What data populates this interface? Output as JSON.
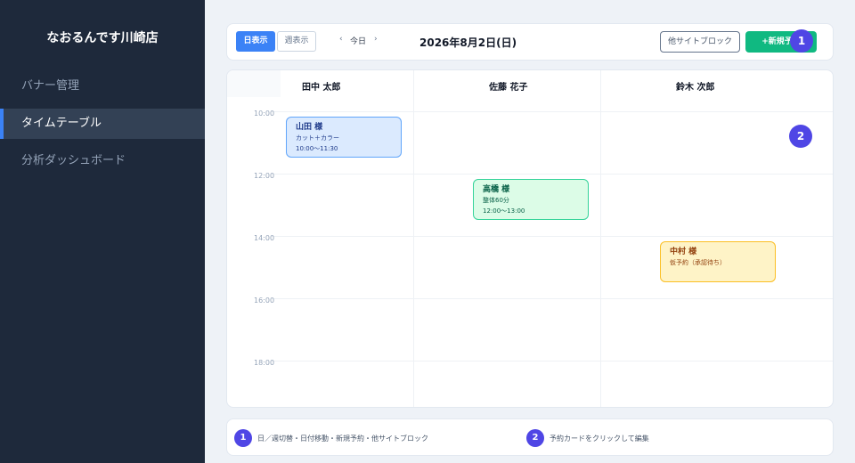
{
  "sidebar": {
    "brand": "なおるんです川崎店",
    "items": [
      {
        "label": "バナー管理"
      },
      {
        "label": "タイムテーブル"
      },
      {
        "label": "分析ダッシュボード"
      }
    ]
  },
  "toolbar": {
    "day_view": "日表示",
    "week_view": "週表示",
    "prev": "‹",
    "today": "今日",
    "next": "›",
    "date": "2026年8月2日(日)",
    "block_button": "他サイトブロック",
    "new_button": "+新規予約"
  },
  "badges": [
    "1",
    "2"
  ],
  "staff": [
    "田中 太郎",
    "佐藤 花子",
    "鈴木 次郎"
  ],
  "times": [
    "10:00",
    "12:00",
    "14:00",
    "16:00",
    "18:00"
  ],
  "appointments": [
    {
      "name": "山田 様",
      "detail": "カット＋カラー",
      "time": "10:00〜11:30",
      "color": "#dbeafe"
    },
    {
      "name": "高橋 様",
      "detail": "整体60分",
      "time": "12:00〜13:00",
      "color": "#dcfce7"
    },
    {
      "name": "中村 様",
      "detail": "仮予約（承認待ち）",
      "time": "",
      "color": "#fef3c7"
    }
  ],
  "legend": [
    {
      "number": "1",
      "text": "日／週切替・日付移動・新規予約・他サイトブロック"
    },
    {
      "number": "2",
      "text": "予約カードをクリックして編集"
    }
  ]
}
